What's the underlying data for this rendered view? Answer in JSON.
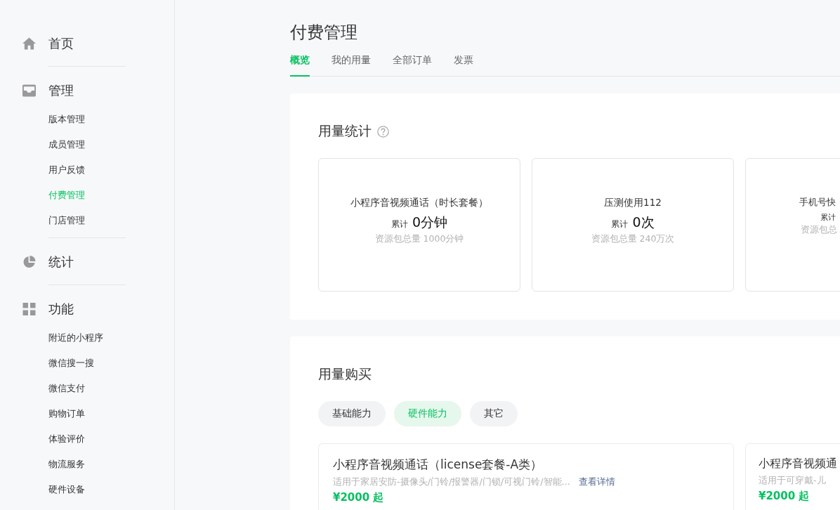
{
  "sidebar": {
    "groups": [
      {
        "label": "首页"
      },
      {
        "label": "管理",
        "items": [
          {
            "label": "版本管理",
            "selected": false
          },
          {
            "label": "成员管理",
            "selected": false
          },
          {
            "label": "用户反馈",
            "selected": false
          },
          {
            "label": "付费管理",
            "selected": true
          },
          {
            "label": "门店管理",
            "selected": false
          }
        ]
      },
      {
        "label": "统计"
      },
      {
        "label": "功能",
        "items": [
          {
            "label": "附近的小程序",
            "selected": false
          },
          {
            "label": "微信搜一搜",
            "selected": false
          },
          {
            "label": "微信支付",
            "selected": false
          },
          {
            "label": "购物订单",
            "selected": false
          },
          {
            "label": "体验评价",
            "selected": false
          },
          {
            "label": "物流服务",
            "selected": false
          },
          {
            "label": "硬件设备",
            "selected": false
          }
        ]
      }
    ]
  },
  "page": {
    "title": "付费管理"
  },
  "tabs": [
    {
      "label": "概览",
      "selected": true
    },
    {
      "label": "我的用量",
      "selected": false
    },
    {
      "label": "全部订单",
      "selected": false
    },
    {
      "label": "发票",
      "selected": false
    }
  ],
  "usage": {
    "title": "用量统计",
    "cards": [
      {
        "title": "小程序音视频通话（时长套餐）",
        "prefix": "累计",
        "value": "0分钟",
        "total": "资源包总量 1000分钟"
      },
      {
        "title": "压测使用112",
        "prefix": "累计",
        "value": "0次",
        "total": "资源包总量 240万次"
      },
      {
        "title": "手机号快",
        "prefix": "累计",
        "total": "资源包总"
      }
    ]
  },
  "purchase": {
    "title": "用量购买",
    "filters": [
      {
        "label": "基础能力",
        "selected": false
      },
      {
        "label": "硬件能力",
        "selected": true
      },
      {
        "label": "其它",
        "selected": false
      }
    ],
    "products": [
      {
        "title": "小程序音视频通话（license套餐-A类）",
        "desc": "适用于家居安防-摄像头/门铃/报警器/门锁/可视门铃/智能...",
        "link": "查看详情",
        "price": "¥2000 起"
      },
      {
        "title": "小程序音视频通",
        "desc": "适用于可穿戴-儿",
        "price": "¥2000 起"
      }
    ]
  }
}
